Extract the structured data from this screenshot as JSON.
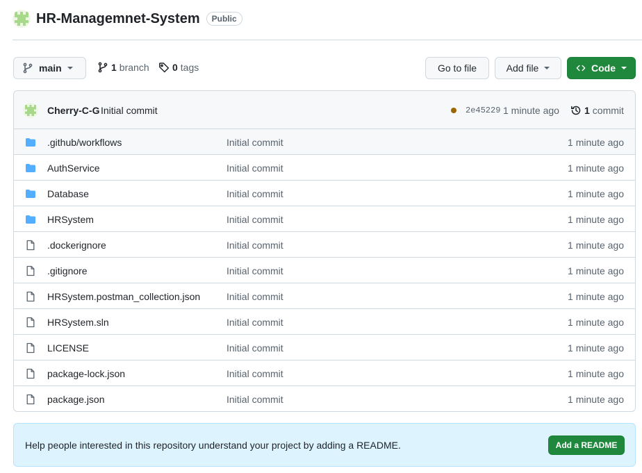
{
  "repo": {
    "title": "HR-Managemnet-System",
    "visibility": "Public"
  },
  "toolbar": {
    "branch": "main",
    "branch_count": "1",
    "branch_label": "branch",
    "tag_count": "0",
    "tag_label": "tags",
    "go_to_file": "Go to file",
    "add_file": "Add file",
    "code": "Code"
  },
  "commit": {
    "author": "Cherry-C-G",
    "message": "Initial commit",
    "sha": "2e45229",
    "time": "1 minute ago",
    "count": "1",
    "count_label": "commit",
    "status_color": "#9a6700"
  },
  "files": [
    {
      "name": ".github/workflows",
      "type": "folder",
      "commit": "Initial commit",
      "time": "1 minute ago"
    },
    {
      "name": "AuthService",
      "type": "folder",
      "commit": "Initial commit",
      "time": "1 minute ago"
    },
    {
      "name": "Database",
      "type": "folder",
      "commit": "Initial commit",
      "time": "1 minute ago"
    },
    {
      "name": "HRSystem",
      "type": "folder",
      "commit": "Initial commit",
      "time": "1 minute ago"
    },
    {
      "name": ".dockerignore",
      "type": "file",
      "commit": "Initial commit",
      "time": "1 minute ago"
    },
    {
      "name": ".gitignore",
      "type": "file",
      "commit": "Initial commit",
      "time": "1 minute ago"
    },
    {
      "name": "HRSystem.postman_collection.json",
      "type": "file",
      "commit": "Initial commit",
      "time": "1 minute ago"
    },
    {
      "name": "HRSystem.sln",
      "type": "file",
      "commit": "Initial commit",
      "time": "1 minute ago"
    },
    {
      "name": "LICENSE",
      "type": "file",
      "commit": "Initial commit",
      "time": "1 minute ago"
    },
    {
      "name": "package-lock.json",
      "type": "file",
      "commit": "Initial commit",
      "time": "1 minute ago"
    },
    {
      "name": "package.json",
      "type": "file",
      "commit": "Initial commit",
      "time": "1 minute ago"
    }
  ],
  "readme": {
    "text": "Help people interested in this repository understand your project by adding a README.",
    "button": "Add a README"
  },
  "colors": {
    "accent_green": "#1f883d",
    "folder_blue": "#54aeff",
    "banner_bg": "#ddf4ff"
  }
}
